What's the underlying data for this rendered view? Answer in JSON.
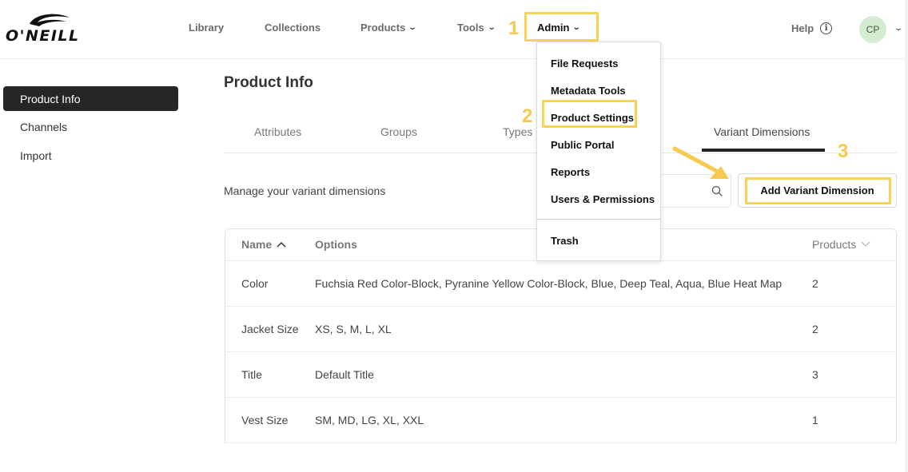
{
  "brand": {
    "logo_text": "O'NEILL"
  },
  "nav": {
    "library": "Library",
    "collections": "Collections",
    "products": "Products",
    "tools": "Tools",
    "admin": "Admin",
    "help": "Help",
    "avatar_initials": "CP"
  },
  "admin_menu": {
    "items": [
      "File Requests",
      "Metadata Tools",
      "Product Settings",
      "Public Portal",
      "Reports",
      "Users & Permissions"
    ],
    "trash": "Trash"
  },
  "annotations": {
    "step1": "1",
    "step2": "2",
    "step3": "3",
    "highlight_color": "#f7d354"
  },
  "sidebar": {
    "items": [
      "Product Info",
      "Channels",
      "Import"
    ],
    "active": "Product Info"
  },
  "main": {
    "title": "Product Info",
    "tabs": [
      "Attributes",
      "Groups",
      "Types",
      "Variant Dimensions"
    ],
    "active_tab": "Variant Dimensions",
    "manage_text": "Manage your variant dimensions",
    "add_button": "Add Variant Dimension"
  },
  "table": {
    "headers": {
      "name": "Name",
      "options": "Options",
      "products": "Products"
    },
    "rows": [
      {
        "name": "Color",
        "options": "Fuchsia Red Color-Block, Pyranine Yellow Color-Block, Blue, Deep Teal, Aqua, Blue Heat Map",
        "products": "2"
      },
      {
        "name": "Jacket Size",
        "options": "XS, S, M, L, XL",
        "products": "2"
      },
      {
        "name": "Title",
        "options": "Default Title",
        "products": "3"
      },
      {
        "name": "Vest Size",
        "options": "SM, MD, LG, XL, XXL",
        "products": "1"
      }
    ]
  },
  "icons": {
    "search": "search-icon",
    "info": "info-icon",
    "chevron": "chevron-down-icon",
    "sort_up": "chevron-up-icon"
  }
}
